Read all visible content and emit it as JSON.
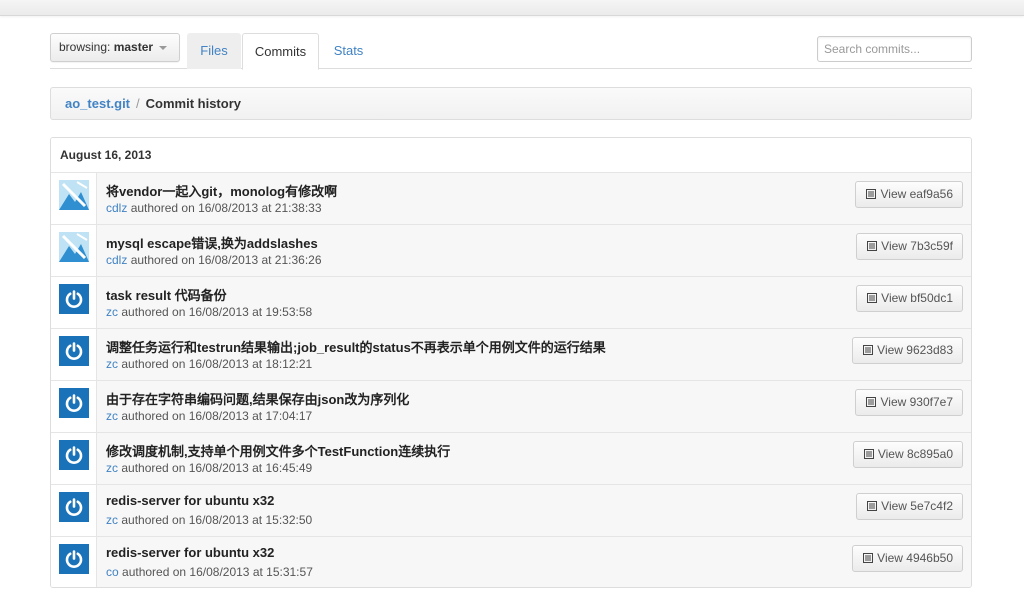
{
  "toolbar": {
    "browsing_label": "browsing: ",
    "branch": "master",
    "tabs": [
      {
        "label": "Files"
      },
      {
        "label": "Commits"
      },
      {
        "label": "Stats"
      }
    ],
    "search_placeholder": "Search commits..."
  },
  "breadcrumb": {
    "repo": "ao_test.git",
    "separator": "/",
    "current": "Commit history"
  },
  "commits": {
    "date": "August 16, 2013",
    "authored_on_text": "authored on",
    "view_prefix": "View",
    "items": [
      {
        "message": "将vendor一起入git，monolog有修改啊",
        "author": "cdlz",
        "authored": "authored on 16/08/2013 at 21:38:33",
        "view": "View eaf9a56",
        "avatar": "photo"
      },
      {
        "message": "mysql escape错误,换为addslashes",
        "author": "cdlz",
        "authored": "authored on 16/08/2013 at 21:36:26",
        "view": "View 7b3c59f",
        "avatar": "photo"
      },
      {
        "message": "task result 代码备份",
        "author": "zc",
        "authored": "authored on 16/08/2013 at 19:53:58",
        "view": "View bf50dc1",
        "avatar": "power"
      },
      {
        "message": "调整任务运行和testrun结果输出;job_result的status不再表示单个用例文件的运行结果",
        "author": "zc",
        "authored": "authored on 16/08/2013 at 18:12:21",
        "view": "View 9623d83",
        "avatar": "power"
      },
      {
        "message": "由于存在字符串编码问题,结果保存由json改为序列化",
        "author": "zc",
        "authored": "authored on 16/08/2013 at 17:04:17",
        "view": "View 930f7e7",
        "avatar": "power"
      },
      {
        "message": "修改调度机制,支持单个用例文件多个TestFunction连续执行",
        "author": "zc",
        "authored": "authored on 16/08/2013 at 16:45:49",
        "view": "View 8c895a0",
        "avatar": "power"
      },
      {
        "message": "redis-server for ubuntu x32",
        "author": "zc",
        "authored": "authored on 16/08/2013 at 15:32:50",
        "view": "View 5e7c4f2",
        "avatar": "power"
      },
      {
        "message": "redis-server for ubuntu x32",
        "author": "co",
        "authored": "authored on 16/08/2013 at 15:31:57",
        "view": "View 4946b50",
        "avatar": "power"
      }
    ]
  },
  "colors": {
    "link": "#4183c4",
    "avatar_blue": "#1a73b8"
  },
  "icons": {
    "branch_caret": "chevron-down-icon",
    "view_button": "document-icon",
    "avatar_power": "power-icon"
  }
}
